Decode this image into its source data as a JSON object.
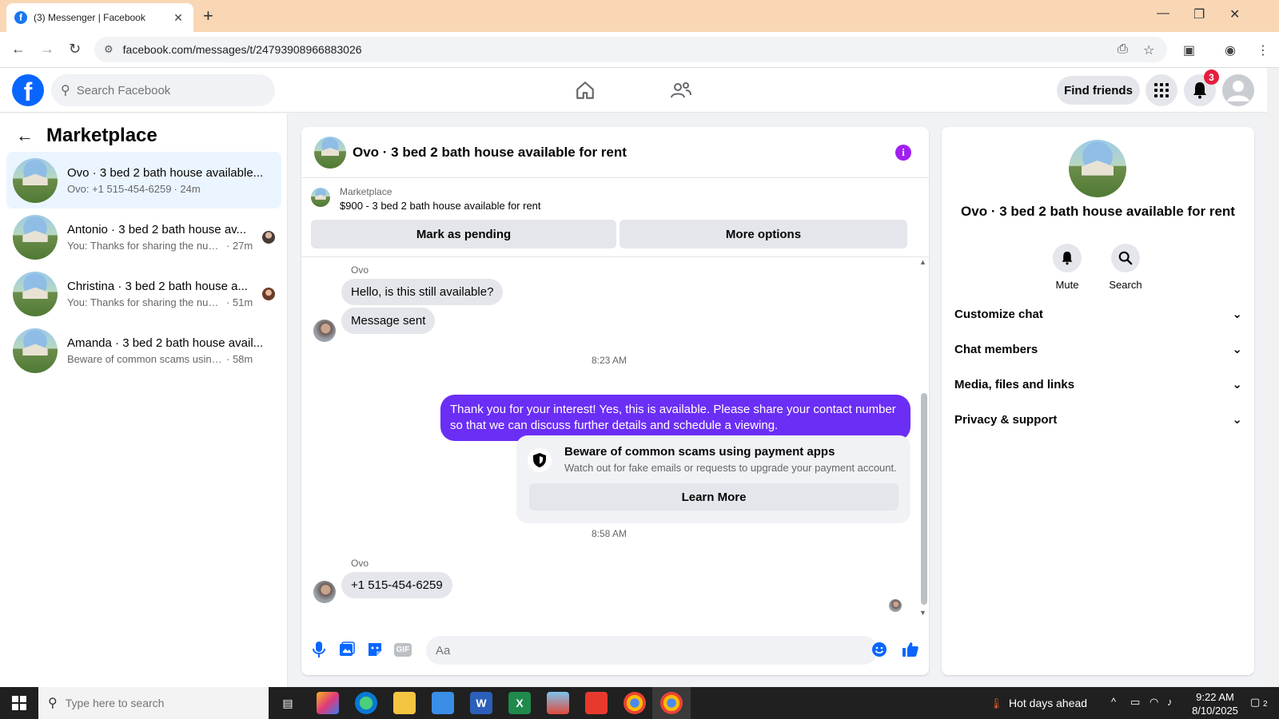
{
  "browser": {
    "tab_title": "(3) Messenger | Facebook",
    "url": "facebook.com/messages/t/24793908966883026"
  },
  "header": {
    "search_placeholder": "Search Facebook",
    "find_friends": "Find friends",
    "notification_count": "3"
  },
  "sidebar": {
    "title": "Marketplace",
    "conversations": [
      {
        "name": "Ovo · 3 bed 2 bath house available...",
        "snippet": "Ovo: +1 515-454-6259",
        "time": "· 24m",
        "active": true
      },
      {
        "name": "Antonio · 3 bed 2 bath house av...",
        "snippet": "You: Thanks for sharing the num...",
        "time": "· 27m",
        "active": false
      },
      {
        "name": "Christina · 3 bed 2 bath house a...",
        "snippet": "You: Thanks for sharing the num...",
        "time": "· 51m",
        "active": false
      },
      {
        "name": "Amanda · 3 bed 2 bath house avail...",
        "snippet": "Beware of common scams using pa...",
        "time": "· 58m",
        "active": false
      }
    ]
  },
  "chat": {
    "title": "Ovo · 3 bed 2 bath house available for rent",
    "listing_source": "Marketplace",
    "listing_title": "$900 - 3 bed 2 bath house available for rent",
    "mark_pending": "Mark as pending",
    "more_options": "More options",
    "messages": {
      "sender1": "Ovo",
      "in1": "Hello, is this still available?",
      "in2": "Message sent",
      "time1": "8:23 AM",
      "out1": "Thank you for your interest! Yes, this is available. Please share your contact number so that we can discuss further details and schedule a viewing.",
      "scam_title": "Beware of common scams using payment apps",
      "scam_text": "Watch out for fake emails or requests to upgrade your payment account.",
      "learn_more": "Learn More",
      "time2": "8:58 AM",
      "sender2": "Ovo",
      "in3": "+1 515-454-6259"
    },
    "composer_placeholder": "Aa",
    "gif_label": "GIF"
  },
  "details": {
    "title": "Ovo · 3 bed 2 bath house available for rent",
    "mute": "Mute",
    "search": "Search",
    "sections": [
      "Customize chat",
      "Chat members",
      "Media, files and links",
      "Privacy & support"
    ]
  },
  "taskbar": {
    "search_placeholder": "Type here to search",
    "weather": "Hot days ahead",
    "time": "9:22 AM",
    "date": "8/10/2025",
    "notif_count": "2"
  },
  "colors": {
    "fb_blue": "#0866ff",
    "sent_bubble": "#6b2ef5",
    "info_icon": "#a020f0",
    "badge": "#e41e3f"
  }
}
